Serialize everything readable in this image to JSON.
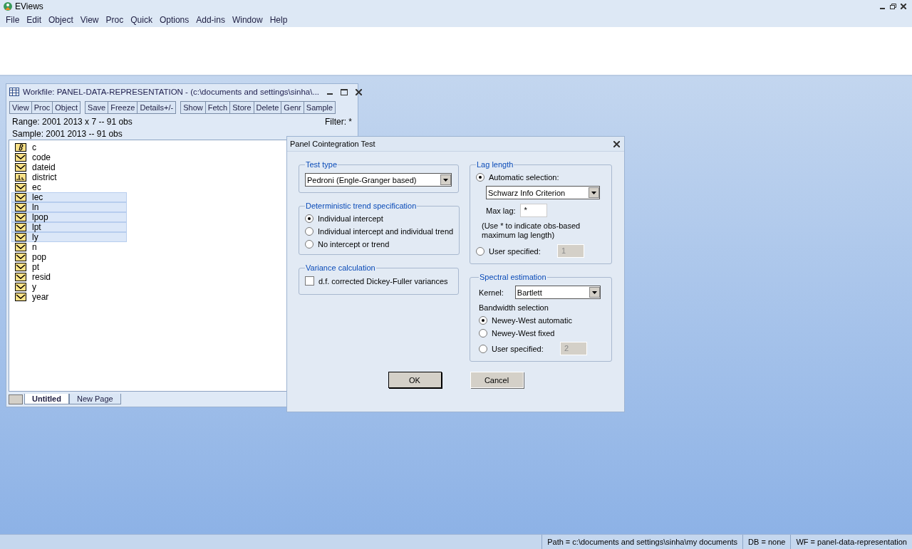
{
  "app": {
    "title": "EViews"
  },
  "menu": [
    "File",
    "Edit",
    "Object",
    "View",
    "Proc",
    "Quick",
    "Options",
    "Add-ins",
    "Window",
    "Help"
  ],
  "workfile": {
    "title": "Workfile: PANEL-DATA-REPRESENTATION - (c:\\documents and settings\\sinha\\...",
    "toolbar": [
      [
        "View",
        "Proc",
        "Object"
      ],
      [
        "Save",
        "Freeze",
        "Details+/-"
      ],
      [
        "Show",
        "Fetch",
        "Store",
        "Delete",
        "Genr",
        "Sample"
      ]
    ],
    "range": "Range:  2001 2013 x 7   --   91 obs",
    "filter": "Filter: *",
    "sample": "Sample: 2001 2013  --   91 obs",
    "objects": [
      {
        "name": "c",
        "kind": "coef",
        "selected": false
      },
      {
        "name": "code",
        "kind": "series",
        "selected": false
      },
      {
        "name": "dateid",
        "kind": "series",
        "selected": false
      },
      {
        "name": "district",
        "kind": "alpha",
        "selected": false
      },
      {
        "name": "ec",
        "kind": "series",
        "selected": false
      },
      {
        "name": "lec",
        "kind": "series",
        "selected": true
      },
      {
        "name": "ln",
        "kind": "series",
        "selected": true
      },
      {
        "name": "lpop",
        "kind": "series",
        "selected": true
      },
      {
        "name": "lpt",
        "kind": "series",
        "selected": true
      },
      {
        "name": "ly",
        "kind": "series",
        "selected": true
      },
      {
        "name": "n",
        "kind": "series",
        "selected": false
      },
      {
        "name": "pop",
        "kind": "series",
        "selected": false
      },
      {
        "name": "pt",
        "kind": "series",
        "selected": false
      },
      {
        "name": "resid",
        "kind": "series",
        "selected": false
      },
      {
        "name": "y",
        "kind": "series",
        "selected": false
      },
      {
        "name": "year",
        "kind": "series",
        "selected": false
      }
    ],
    "tabs": [
      {
        "label": "Untitled",
        "selected": true
      },
      {
        "label": "New Page",
        "selected": false
      }
    ]
  },
  "dialog": {
    "title": "Panel Cointegration Test",
    "test_type": {
      "legend": "Test type",
      "value": "Pedroni (Engle-Granger based)"
    },
    "trend": {
      "legend": "Deterministic trend specification",
      "options": [
        {
          "label": "Individual intercept",
          "selected": true
        },
        {
          "label": "Individual intercept and individual trend",
          "selected": false
        },
        {
          "label": "No intercept or trend",
          "selected": false
        }
      ]
    },
    "variance": {
      "legend": "Variance calculation",
      "label": "d.f. corrected Dickey-Fuller variances",
      "checked": false
    },
    "lag": {
      "legend": "Lag length",
      "auto_label": "Automatic selection:",
      "auto_selected": true,
      "criterion": "Schwarz Info Criterion",
      "max_lag_label": "Max lag:",
      "max_lag_value": "*",
      "note": "(Use * to indicate obs-based maximum lag length)",
      "user_label": "User specified:",
      "user_selected": false,
      "user_value": "1"
    },
    "spectral": {
      "legend": "Spectral estimation",
      "kernel_label": "Kernel:",
      "kernel_value": "Bartlett",
      "bandwidth_label": "Bandwidth selection",
      "options": [
        {
          "label": "Newey-West automatic",
          "selected": true
        },
        {
          "label": "Newey-West fixed",
          "selected": false
        },
        {
          "label": "User specified:",
          "selected": false,
          "value": "2"
        }
      ]
    },
    "buttons": [
      {
        "label": "OK",
        "default": true
      },
      {
        "label": "Cancel",
        "default": false
      }
    ]
  },
  "status": [
    "Path = c:\\documents and settings\\sinha\\my documents",
    "DB = none",
    "WF = panel-data-representation"
  ]
}
